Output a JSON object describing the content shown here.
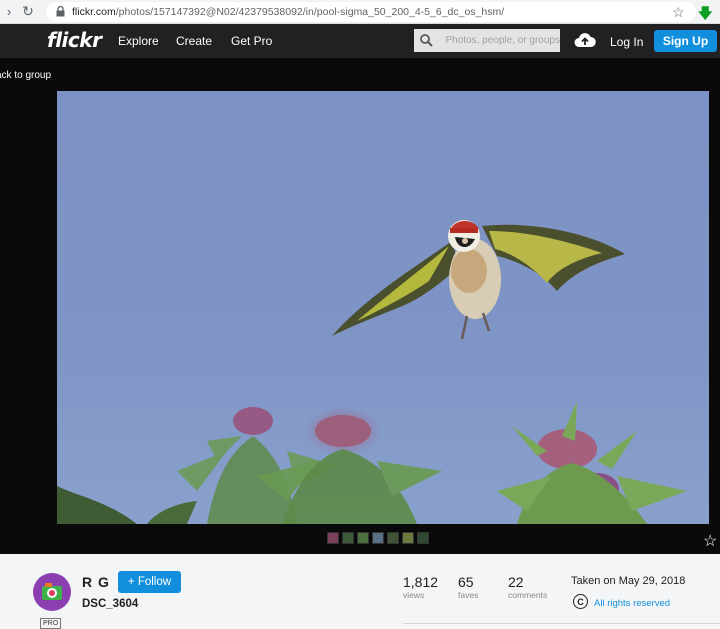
{
  "browser": {
    "url_host": "flickr.com",
    "url_path": "/photos/157147392@N02/42379538092/in/pool-sigma_50_200_4-5_6_dc_os_hsm/",
    "icons": {
      "back": "back-arrow-icon",
      "reload": "reload-icon",
      "lock": "lock-icon",
      "star": "bookmark-star-icon",
      "extension": "download-arrow-icon"
    }
  },
  "header": {
    "logo": "flickr",
    "nav": [
      "Explore",
      "Create",
      "Get Pro"
    ],
    "search_placeholder": "Photos, people, or groups",
    "login": "Log In",
    "signup": "Sign Up",
    "colors": {
      "bar": "#212124",
      "accent": "#128fdc"
    }
  },
  "photo_page": {
    "back_link": "ack to group",
    "thumb_colors": [
      "#7a3f5a",
      "#3d5a3a",
      "#4d6f3f",
      "#5a6f8a",
      "#3f5535",
      "#6a7a3f",
      "#2f4a30"
    ]
  },
  "info": {
    "owner": "R G",
    "follow_label": "+ Follow",
    "photo_title": "DSC_3604",
    "pro_badge": "PRO",
    "stats": [
      {
        "value": "1,812",
        "label": "views"
      },
      {
        "value": "65",
        "label": "faves"
      },
      {
        "value": "22",
        "label": "comments"
      }
    ],
    "taken": "Taken on May 29, 2018",
    "rights": "All rights reserved"
  }
}
